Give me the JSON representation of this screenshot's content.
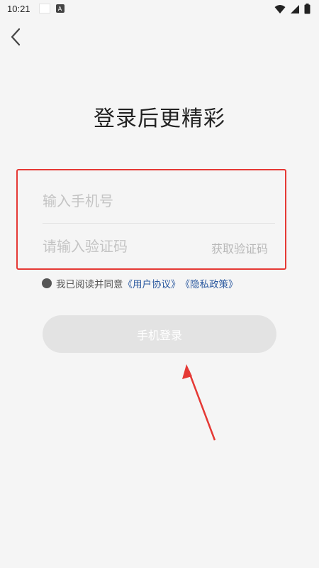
{
  "status_bar": {
    "time": "10:21",
    "icons": [
      "notification-square-icon",
      "a-badge-icon",
      "wifi-icon",
      "signal-icon",
      "battery-icon"
    ]
  },
  "nav": {
    "back_icon": "chevron-left-icon"
  },
  "title": "登录后更精彩",
  "form": {
    "phone_placeholder": "输入手机号",
    "phone_value": "",
    "code_placeholder": "请输入验证码",
    "code_value": "",
    "get_code_label": "获取验证码",
    "highlight_color": "#e53935"
  },
  "agreement": {
    "checked": false,
    "prefix": "我已阅读并同意",
    "user_agreement": "《用户协议》",
    "privacy_policy": "《隐私政策》",
    "link_color": "#2c5aa0"
  },
  "login_button_label": "手机登录",
  "annotation": {
    "arrow_color": "#e53935"
  }
}
